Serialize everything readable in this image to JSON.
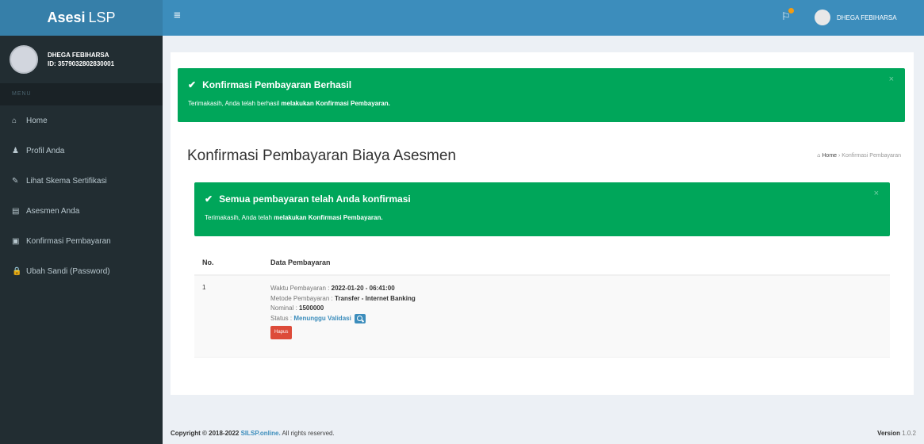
{
  "logo": {
    "bold": "Asesi",
    "rest": "LSP"
  },
  "user_panel": {
    "name": "DHEGA FEBIHARSA",
    "id": "ID: 3579032802830001"
  },
  "menu_header": "MENU",
  "menu": [
    {
      "icon": "home-icon",
      "glyph": "⌂",
      "label": "Home"
    },
    {
      "icon": "user-icon",
      "glyph": "♟",
      "label": "Profil Anda"
    },
    {
      "icon": "edit-icon",
      "glyph": "✎",
      "label": "Lihat Skema Sertifikasi"
    },
    {
      "icon": "list-icon",
      "glyph": "▤",
      "label": "Asesmen Anda"
    },
    {
      "icon": "payment-icon",
      "glyph": "▣",
      "label": "Konfirmasi Pembayaran"
    },
    {
      "icon": "lock-icon",
      "glyph": "🔒",
      "label": "Ubah Sandi (Password)"
    }
  ],
  "topbar": {
    "user_name": "DHEGA FEBIHARSA"
  },
  "alert_top": {
    "title": "Konfirmasi Pembayaran Berhasil",
    "text_plain": "Terimakasih, Anda telah berhasil ",
    "text_bold": "melakukan Konfirmasi Pembayaran."
  },
  "page": {
    "title": "Konfirmasi Pembayaran Biaya Asesmen",
    "breadcrumb_home": "Home",
    "breadcrumb_sep": " › ",
    "breadcrumb_current": "Konfirmasi Pembayaran"
  },
  "alert_inner": {
    "title": "Semua pembayaran telah Anda konfirmasi",
    "text_plain": "Terimakasih, Anda telah ",
    "text_bold": "melakukan Konfirmasi Pembayaran."
  },
  "table": {
    "col_no": "No.",
    "col_data": "Data Pembayaran",
    "rows": [
      {
        "no": "1",
        "waktu_label": "Waktu Pembayaran : ",
        "waktu": "2022-01-20 - 06:41:00",
        "metode_label": "Metode Pembayaran : ",
        "metode": "Transfer - Internet Banking",
        "nominal_label": "Nominal : ",
        "nominal": "1500000",
        "status_label": "Status : ",
        "status": "Menunggu Validasi",
        "delete_label": "Hapus"
      }
    ]
  },
  "footer": {
    "copyright": "Copyright © 2018-2022 ",
    "brand": "SILSP.online.",
    "rights": " All rights reserved.",
    "version_label": "Version ",
    "version": "1.0.2"
  },
  "colors": {
    "accent": "#3c8dbc",
    "success": "#00a65a",
    "danger": "#dd4b39",
    "sidebar": "#222d32"
  }
}
